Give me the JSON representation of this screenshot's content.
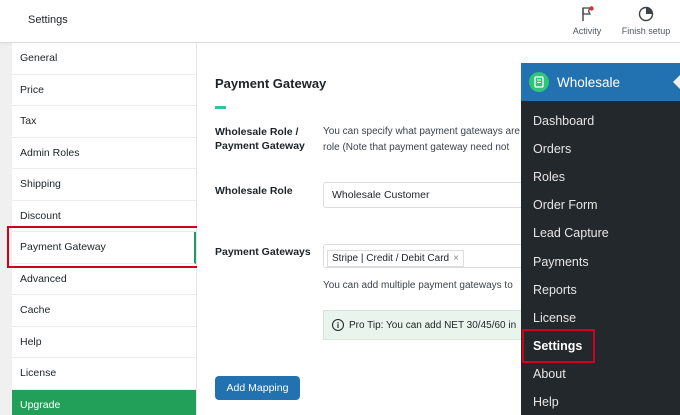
{
  "header": {
    "title": "Settings",
    "actions": [
      {
        "label": "Activity",
        "icon": "flag-icon"
      },
      {
        "label": "Finish setup",
        "icon": "progress-circle-icon"
      }
    ]
  },
  "sidenav": {
    "items": [
      {
        "label": "General"
      },
      {
        "label": "Price"
      },
      {
        "label": "Tax"
      },
      {
        "label": "Admin Roles"
      },
      {
        "label": "Shipping"
      },
      {
        "label": "Discount"
      },
      {
        "label": "Payment Gateway",
        "active": true
      },
      {
        "label": "Advanced"
      },
      {
        "label": "Cache"
      },
      {
        "label": "Help"
      },
      {
        "label": "License"
      },
      {
        "label": "Upgrade"
      }
    ]
  },
  "main": {
    "section_title": "Payment Gateway",
    "role_gateway_label_line1": "Wholesale Role /",
    "role_gateway_label_line2": "Payment Gateway",
    "role_gateway_desc_line1": "You can specify what payment gateways are",
    "role_gateway_desc_line2": "role (Note that payment gateway need not",
    "wholesale_role_label": "Wholesale Role",
    "wholesale_role_value": "Wholesale Customer",
    "payment_gateways_label": "Payment Gateways",
    "selected_gateway": "Stripe | Credit / Debit Card",
    "multi_note": "You can add multiple payment gateways to",
    "pro_tip": "Pro Tip: You can add NET 30/45/60 in",
    "add_mapping_button": "Add Mapping"
  },
  "wp_menu": {
    "title": "Wholesale",
    "items": [
      "Dashboard",
      "Orders",
      "Roles",
      "Order Form",
      "Lead Capture",
      "Payments",
      "Reports",
      "License",
      "Settings",
      "About",
      "Help"
    ],
    "current": "Settings"
  },
  "colors": {
    "accent_green": "#22a05a",
    "wp_blue": "#2271b1",
    "wp_dark": "#23282d",
    "highlight_red": "#d0021b"
  }
}
